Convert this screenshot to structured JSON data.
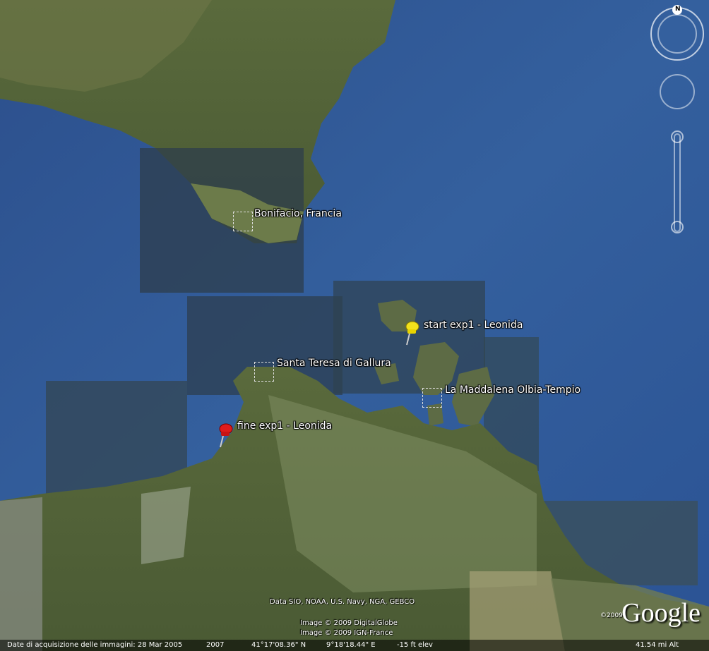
{
  "places": {
    "bonifacio": "Bonifacio, Francia",
    "santa_teresa": "Santa Teresa di Gallura",
    "maddalena": "La Maddalena Olbia-Tempio"
  },
  "placemarks": {
    "start": {
      "label": "start exp1 - Leonida",
      "color": "#f2e21c"
    },
    "end": {
      "label": "fine exp1 - Leonida",
      "color": "#e01b1b"
    }
  },
  "credits": {
    "data": "Data SIO, NOAA, U.S. Navy, NGA, GEBCO",
    "image1": "Image © 2009 DigitalGlobe",
    "image2": "Image © 2009 IGN-France"
  },
  "status": {
    "date": "Date di acquisizione delle immagini: 28 Mar 2005",
    "year": "2007",
    "lat": "41°17'08.36\" N",
    "lon": "9°18'18.44\" E",
    "elev": "-15 ft elev",
    "alt": "41.54 mi Alt"
  },
  "navigation": {
    "north": "N"
  },
  "logo": {
    "text": "Google",
    "year": "©2009"
  }
}
